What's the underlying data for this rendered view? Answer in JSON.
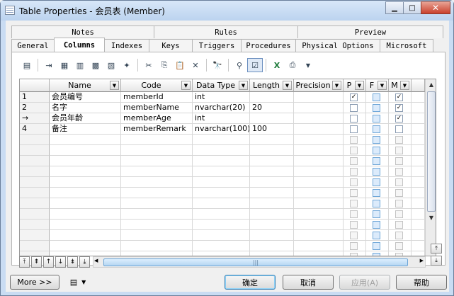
{
  "window": {
    "title": "Table Properties - 会员表 (Member)"
  },
  "tabs_row1": [
    "Notes",
    "Rules",
    "Preview"
  ],
  "tabs_row2": [
    "General",
    "Columns",
    "Indexes",
    "Keys",
    "Triggers",
    "Procedures",
    "Physical Options",
    "Microsoft"
  ],
  "active_tab": "Columns",
  "grid": {
    "headers": [
      "Name",
      "Code",
      "Data Type",
      "Length",
      "Precision",
      "P",
      "F",
      "M"
    ],
    "rows": [
      {
        "num": "1",
        "name": "会员编号",
        "code": "memberId",
        "type": "int",
        "length": "",
        "precision": "",
        "p": true,
        "f": false,
        "m": true
      },
      {
        "num": "2",
        "name": "名字",
        "code": "memberName",
        "type": "nvarchar(20)",
        "length": "20",
        "precision": "",
        "p": false,
        "f": false,
        "m": true
      },
      {
        "num": "→",
        "name": "会员年龄",
        "code": "memberAge",
        "type": "int",
        "length": "",
        "precision": "",
        "p": false,
        "f": false,
        "m": true
      },
      {
        "num": "4",
        "name": "备注",
        "code": "memberRemark",
        "type": "nvarchar(100)",
        "length": "100",
        "precision": "",
        "p": false,
        "f": false,
        "m": false
      }
    ],
    "empty_rows": 12
  },
  "buttons": {
    "more": "More >>",
    "ok": "确定",
    "cancel": "取消",
    "apply": "应用(A)",
    "help": "帮助"
  }
}
